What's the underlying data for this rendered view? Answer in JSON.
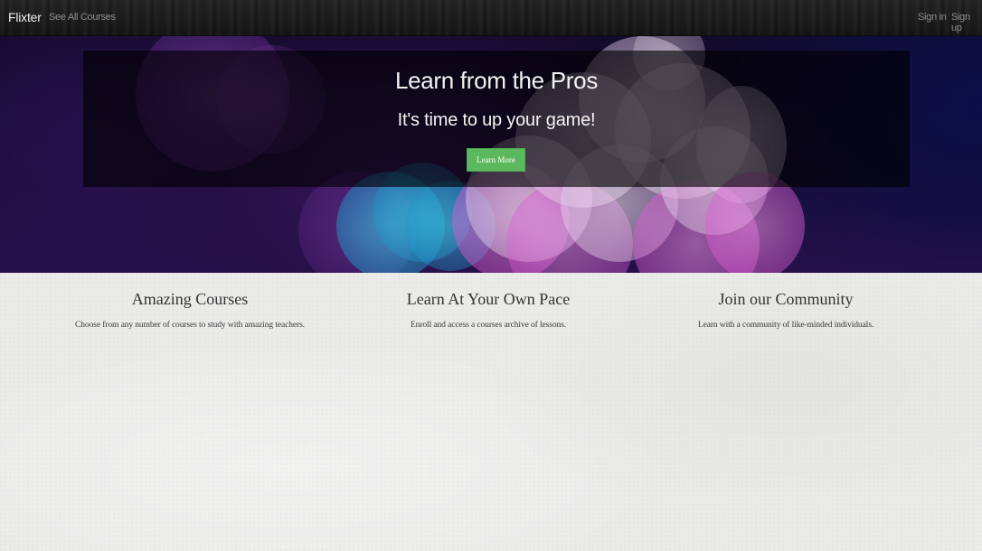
{
  "navbar": {
    "brand": "Flixter",
    "see_all_courses": "See All Courses",
    "sign_in": "Sign in",
    "sign_up": "Sign up"
  },
  "hero": {
    "title": "Learn from the Pros",
    "subtitle": "It's time to up your game!",
    "button_label": "Learn More"
  },
  "features": [
    {
      "title": "Amazing Courses",
      "description": "Choose from any number of courses to study with amazing teachers."
    },
    {
      "title": "Learn At Your Own Pace",
      "description": "Enroll and access a courses archive of lessons."
    },
    {
      "title": "Join our Community",
      "description": "Learn with a community of like-minded individuals."
    }
  ],
  "colors": {
    "navbar_bg": "#1c1c1c",
    "button_green": "#5cb85c",
    "page_bg": "#ebebea"
  }
}
